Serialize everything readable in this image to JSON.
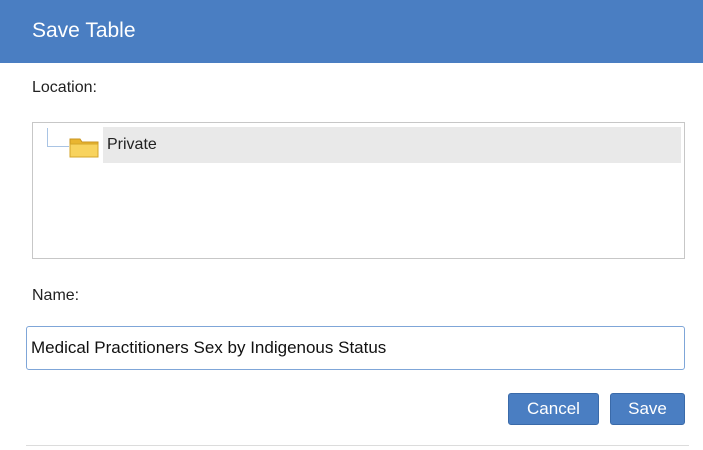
{
  "dialog": {
    "title": "Save Table"
  },
  "location": {
    "label": "Location:",
    "tree": {
      "items": [
        {
          "label": "Private",
          "icon": "folder-icon"
        }
      ]
    }
  },
  "name": {
    "label": "Name:",
    "value": "Medical Practitioners Sex by Indigenous Status"
  },
  "buttons": {
    "cancel_label": "Cancel",
    "save_label": "Save"
  },
  "colors": {
    "accent": "#4a7ec2",
    "selected_row": "#e9e9e9",
    "folder": "#f5c542"
  }
}
